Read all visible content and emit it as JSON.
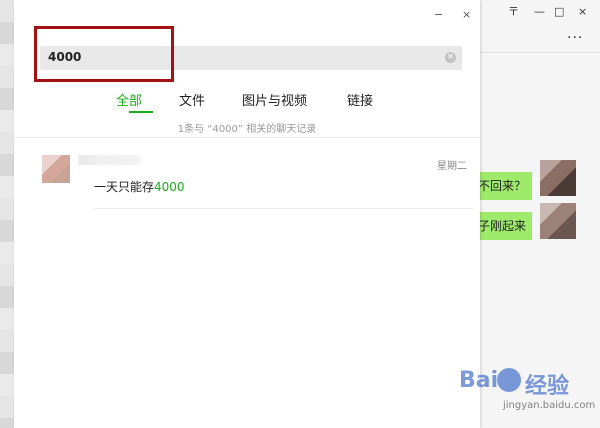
{
  "search": {
    "value": "4000",
    "clear_icon": "×"
  },
  "window": {
    "close": "×",
    "minimize": "−",
    "pin": "〒",
    "min": "—",
    "max": "□",
    "close_main": "×"
  },
  "tabs": [
    {
      "label": "全部",
      "active": true
    },
    {
      "label": "文件",
      "active": false
    },
    {
      "label": "图片与视频",
      "active": false
    },
    {
      "label": "链接",
      "active": false
    }
  ],
  "summary": "1条与 “4000” 相关的聊天记录",
  "result": {
    "date": "星期二",
    "message_prefix": "一天只能存",
    "message_highlight": "4000"
  },
  "chat": {
    "bubble_1": "不回来？",
    "bubble_2": "子刚起来",
    "more": "···"
  },
  "watermark": {
    "brand": "Bai",
    "brand2": "经验",
    "sub": "jingyan.baidu.com"
  },
  "colors": {
    "accent": "#1aad19",
    "highlight_box": "#a31212",
    "bubble": "#9eea6a"
  }
}
